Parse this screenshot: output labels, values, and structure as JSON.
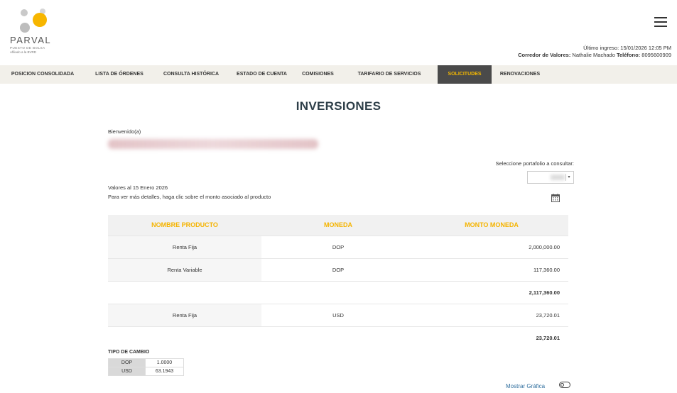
{
  "header": {
    "brand": "PARVAL",
    "brand_sub1": "PUESTO DE BOLSA",
    "brand_sub2": "Afiliado a la BVRD",
    "last_login_label": "Último ingreso: 15/01/2026 12:05 PM",
    "broker_label": "Corredor de Valores:",
    "broker_name": "Nathalie Machado",
    "phone_label": "Teléfono:",
    "phone_value": "8095600909"
  },
  "nav": {
    "items": [
      {
        "label": "POSICION CONSOLIDADA"
      },
      {
        "label": "LISTA DE ÓRDENES"
      },
      {
        "label": "CONSULTA HISTÓRICA"
      },
      {
        "label": "ESTADO DE CUENTA"
      },
      {
        "label": "COMISIONES"
      },
      {
        "label": "TARIFARIO DE SERVICIOS"
      },
      {
        "label": "SOLICITUDES"
      },
      {
        "label": "RENOVACIONES"
      }
    ],
    "active_index": 6,
    "active_bg": "#4a4a4a",
    "active_color": "#f5b800"
  },
  "main": {
    "title": "INVERSIONES",
    "welcome": "Bienvenido(a)",
    "portfolio_label": "Seleccione portafolio a consultar:",
    "values_date": "Valores al 15 Enero 2026",
    "hint": "Para ver más detalles, haga clic sobre el monto asociado al producto"
  },
  "table": {
    "headers": [
      "NOMBRE PRODUCTO",
      "MONEDA",
      "MONTO MONEDA"
    ],
    "rows": [
      {
        "product": "Renta Fija",
        "currency": "DOP",
        "amount": "2,000,000.00"
      },
      {
        "product": "Renta Variable",
        "currency": "DOP",
        "amount": "117,360.00"
      },
      {
        "subtotal": "2,117,360.00"
      },
      {
        "product": "Renta Fija",
        "currency": "USD",
        "amount": "23,720.01"
      },
      {
        "subtotal": "23,720.01"
      }
    ]
  },
  "exchange": {
    "title": "TIPO DE CAMBIO",
    "rates": [
      {
        "currency": "DOP",
        "rate": "1.0000"
      },
      {
        "currency": "USD",
        "rate": "63.1943"
      }
    ]
  },
  "chart_toggle": {
    "label": "Mostrar Gráfica"
  },
  "icons": {
    "menu": "hamburger-menu-icon",
    "calendar": "calendar-icon",
    "toggle": "toggle-switch-icon"
  },
  "colors": {
    "accent": "#f5b400",
    "title": "#2d3e48",
    "link": "#2f6e9e"
  }
}
